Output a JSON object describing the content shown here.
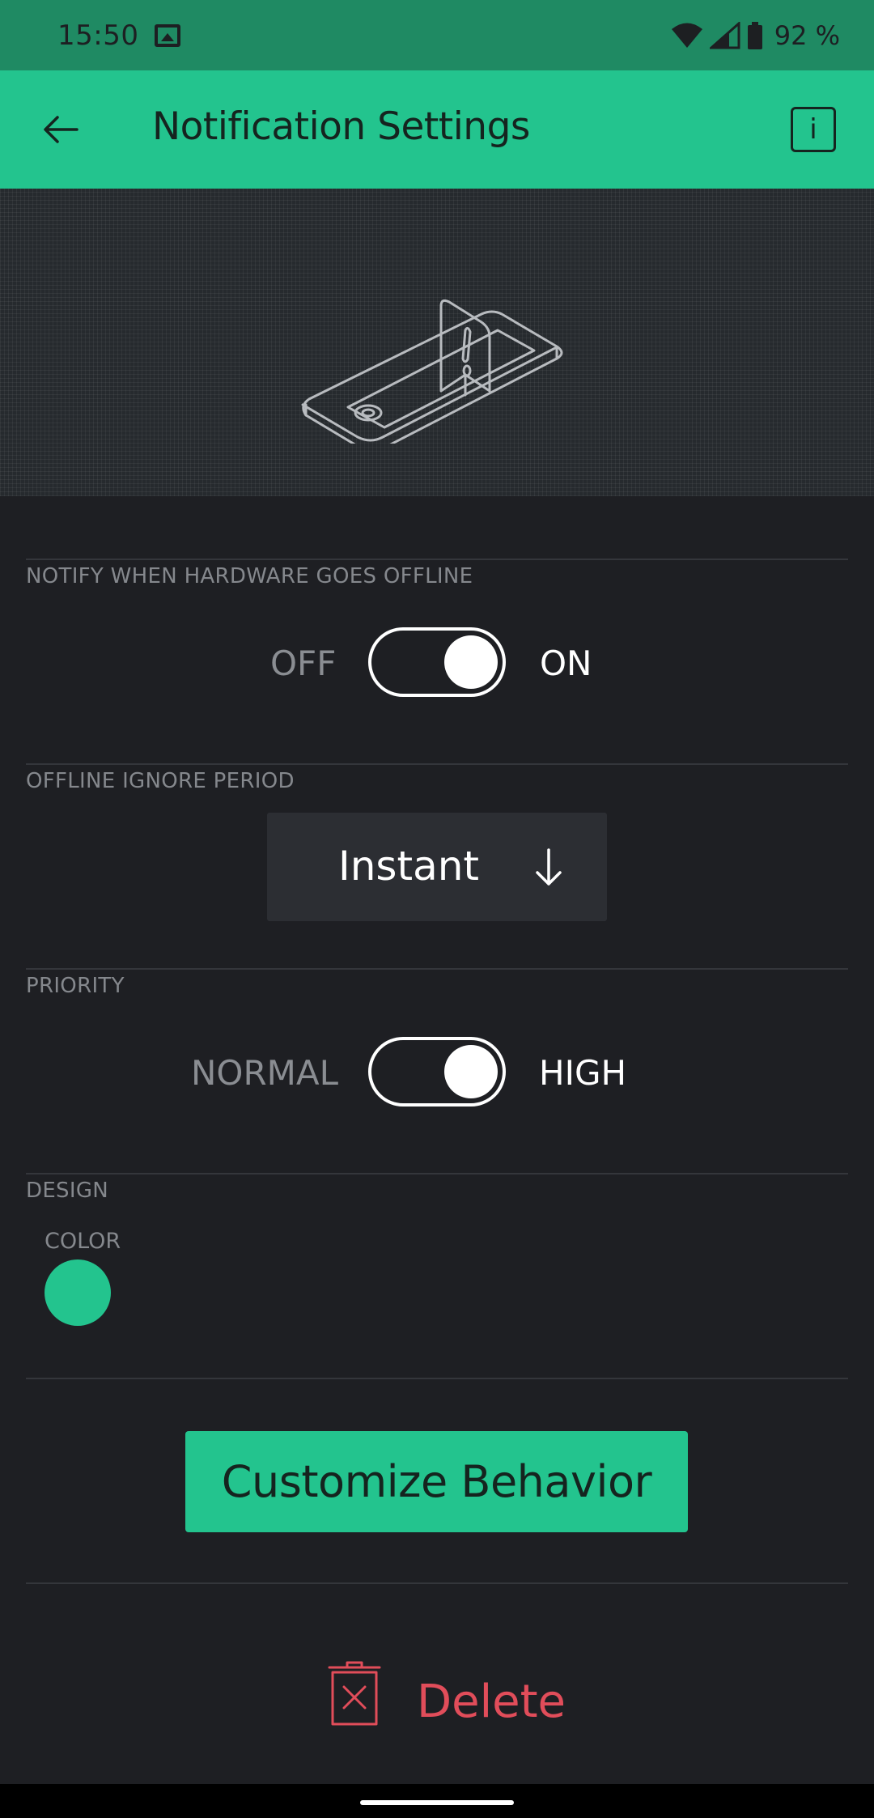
{
  "status_bar": {
    "time": "15:50",
    "battery_text": "92 %",
    "icons": [
      "gallery-icon",
      "wifi-icon",
      "signal-icon",
      "battery-icon"
    ]
  },
  "app_bar": {
    "title": "Notification Settings",
    "back_icon": "arrow-left-icon",
    "info_label": "i"
  },
  "sections": {
    "offline": {
      "label": "NOTIFY WHEN HARDWARE GOES OFFLINE",
      "off_label": "OFF",
      "on_label": "ON",
      "state": "on"
    },
    "ignore_period": {
      "label": "OFFLINE IGNORE PERIOD",
      "value": "Instant"
    },
    "priority": {
      "label": "PRIORITY",
      "off_label": "NORMAL",
      "on_label": "HIGH",
      "state": "high"
    },
    "design": {
      "label": "DESIGN",
      "color_label": "COLOR",
      "color": "#23c48e"
    }
  },
  "actions": {
    "customize_label": "Customize Behavior",
    "delete_label": "Delete"
  },
  "colors": {
    "accent": "#23c48e",
    "status_bar": "#1f8a63",
    "background": "#1e1f23",
    "danger": "#e14d5a"
  }
}
